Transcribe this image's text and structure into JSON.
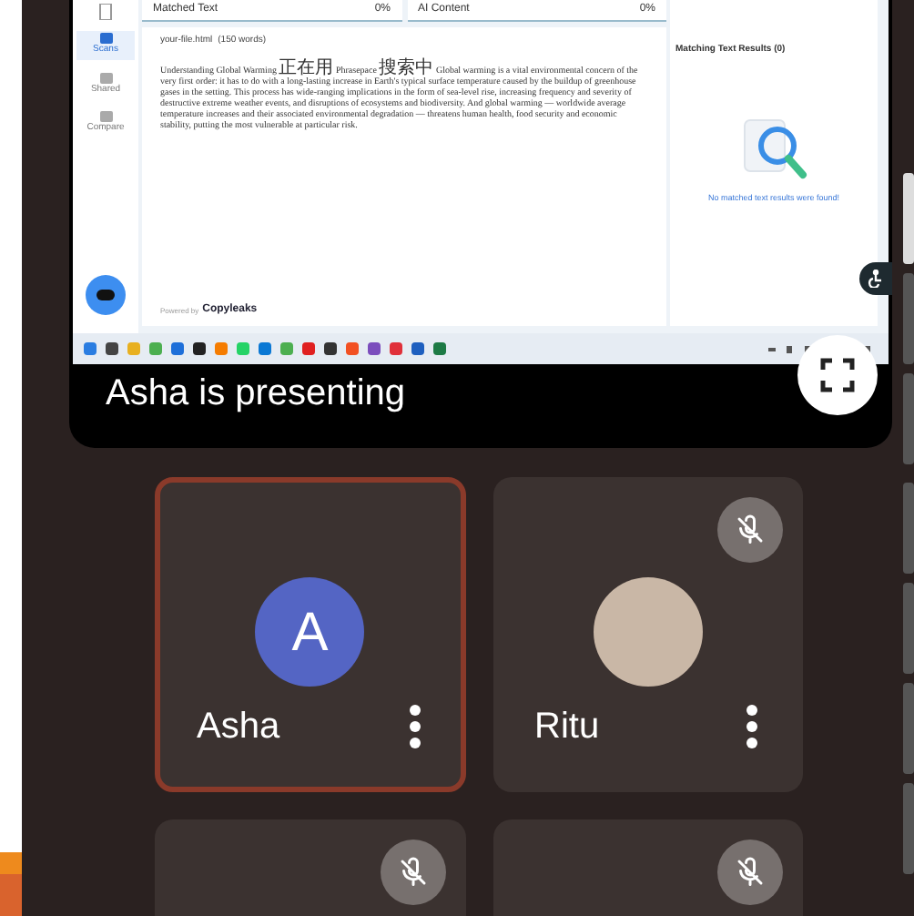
{
  "shared_screen": {
    "sidebar": [
      {
        "label": "Scans",
        "selected": true
      },
      {
        "label": "Shared",
        "selected": false
      },
      {
        "label": "Compare",
        "selected": false
      }
    ],
    "tabs": [
      {
        "label": "Matched Text",
        "value": "0%"
      },
      {
        "label": "AI Content",
        "value": "0%"
      }
    ],
    "file": {
      "name": "your-file.html",
      "words": "(150 words)"
    },
    "paragraph": [
      {
        "kind": "latin",
        "text": "Understanding Global Warming "
      },
      {
        "kind": "cjk",
        "text": "正在用"
      },
      {
        "kind": "latin",
        "text": " Phrasepace "
      },
      {
        "kind": "cjk",
        "text": "搜索中"
      },
      {
        "kind": "latin",
        "text": " Global warming is a vital environmental concern of the very first order: it has to do with a long-lasting increase in Earth's typical surface temperature caused by the buildup of greenhouse gases in the setting. This process has wide-ranging implications in the form of sea-level rise, increasing frequency and severity of destructive extreme weather events, and disruptions of ecosystems and biodiversity. And global warming — worldwide average temperature increases and their associated environmental degradation — threatens human health, food security and economic stability, putting the most vulnerable at particular risk."
      }
    ],
    "powered_by": "Powered by",
    "brand": "Copyleaks",
    "results": {
      "title": "Matching Text Results (0)",
      "empty": "No matched text results were found!"
    }
  },
  "presenting": "Asha is presenting",
  "tiles": [
    {
      "kind": "letter",
      "name": "Asha",
      "avatar": "A",
      "speaking": true,
      "muted": false
    },
    {
      "kind": "photo",
      "name": "Ritu",
      "speaking": false,
      "muted": true
    },
    {
      "kind": "blank",
      "speaking": false,
      "muted": true
    },
    {
      "kind": "blank",
      "speaking": false,
      "muted": true
    }
  ]
}
